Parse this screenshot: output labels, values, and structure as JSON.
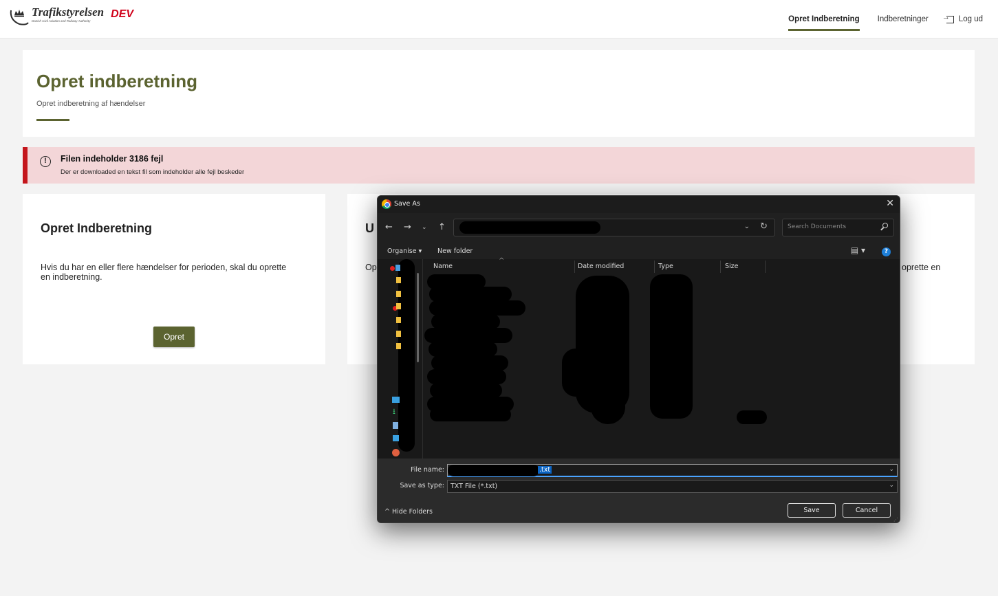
{
  "header": {
    "logo_name": "Trafikstyrelsen",
    "logo_sub": "Danish Civil Aviation and Railway Authority",
    "env_tag": "DEV",
    "nav": {
      "create": "Opret Indberetning",
      "reports": "Indberetninger",
      "logout": "Log ud"
    }
  },
  "page": {
    "title": "Opret indberetning",
    "subtitle": "Opret indberetning af hændelser"
  },
  "alert": {
    "title": "Filen indeholder 3186 fejl",
    "text": "Der er downloaded en tekst fil som indeholder alle fejl beskeder",
    "icon": "!"
  },
  "card_create": {
    "title": "Opret Indberetning",
    "text": "Hvis du har en eller flere hændelser for perioden, skal du oprette en indberetning.",
    "button": "Opret"
  },
  "card_upload": {
    "title_fragment": "U",
    "text_fragment": "Op",
    "text_end": "oprette en"
  },
  "dialog": {
    "title": "Save As",
    "close": "✕",
    "search_placeholder": "Search Documents",
    "toolbar": {
      "organise": "Organise ▾",
      "new_folder": "New folder",
      "view": "▤ ▾",
      "help": "?"
    },
    "columns": {
      "name": "Name",
      "date": "Date modified",
      "type": "Type",
      "size": "Size"
    },
    "form": {
      "filename_label": "File name:",
      "filename_ext": ".txt",
      "savetype_label": "Save as type:",
      "savetype_value": "TXT File (*.txt)",
      "hide_folders": "^ Hide Folders",
      "save": "Save",
      "cancel": "Cancel"
    }
  },
  "colors": {
    "brand_olive": "#5b6330",
    "alert_red": "#c4161c",
    "alert_bg": "#f3d6d8",
    "dev_red": "#d0021b"
  }
}
